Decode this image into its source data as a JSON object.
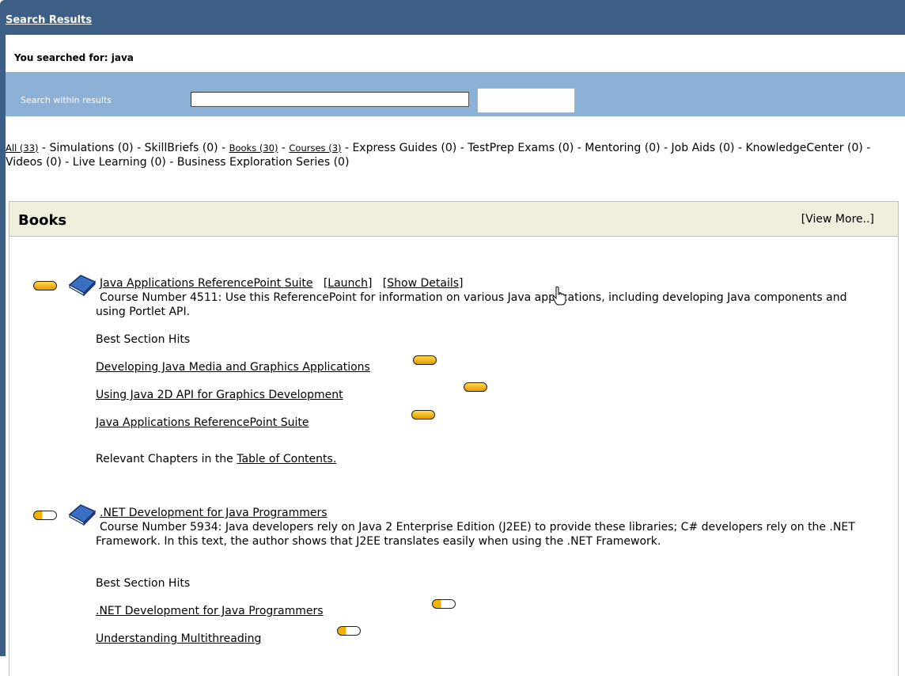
{
  "header": {
    "title": "Search Results"
  },
  "search": {
    "searched_for": "You searched for: java",
    "within_label": "Search within results",
    "within_value": ""
  },
  "filters": [
    {
      "label": "All (33)",
      "link": true
    },
    {
      "label": "Simulations (0)",
      "link": false
    },
    {
      "label": "SkillBriefs (0)",
      "link": false
    },
    {
      "label": "Books (30)",
      "link": true
    },
    {
      "label": "Courses (3)",
      "link": true
    },
    {
      "label": "Express Guides (0)",
      "link": false
    },
    {
      "label": "TestPrep Exams (0)",
      "link": false
    },
    {
      "label": "Mentoring (0)",
      "link": false
    },
    {
      "label": "Job Aids (0)",
      "link": false
    },
    {
      "label": "KnowledgeCenter (0)",
      "link": false
    },
    {
      "label": "Videos (0)",
      "link": false
    },
    {
      "label": "Live Learning (0)",
      "link": false
    },
    {
      "label": "Business Exploration Series (0)",
      "link": false
    }
  ],
  "books": {
    "heading": "Books",
    "view_more": "[View More..]",
    "results": [
      {
        "title": "Java Applications ReferencePoint Suite",
        "launch": "[Launch]",
        "show_details": "[Show Details]",
        "description": "Course Number 4511: Use this ReferencePoint for information on various Java applications, including developing Java components and using Portlet API.",
        "best_hits_label": "Best Section Hits",
        "hits": [
          "Developing Java Media and Graphics Applications",
          "Using Java 2D API for Graphics Development",
          "Java Applications ReferencePoint Suite"
        ],
        "relevant_prefix": "Relevant Chapters in the",
        "toc_link": "Table of Contents."
      },
      {
        "title": ".NET Development for Java Programmers",
        "description": "Course Number 5934: Java developers rely on Java 2 Enterprise Edition (J2EE) to provide these libraries; C# developers rely on the .NET Framework. In this text, the author shows that J2EE translates easily when using the .NET Framework.",
        "best_hits_label": "Best Section Hits",
        "hits": [
          ".NET Development for Java Programmers",
          "Understanding Multithreading"
        ]
      }
    ]
  },
  "icons": {
    "relevance_full": "relevance-pill-full-icon",
    "relevance_low": "relevance-pill-low-icon",
    "book": "book-icon",
    "cursor": "hand-cursor-icon"
  }
}
